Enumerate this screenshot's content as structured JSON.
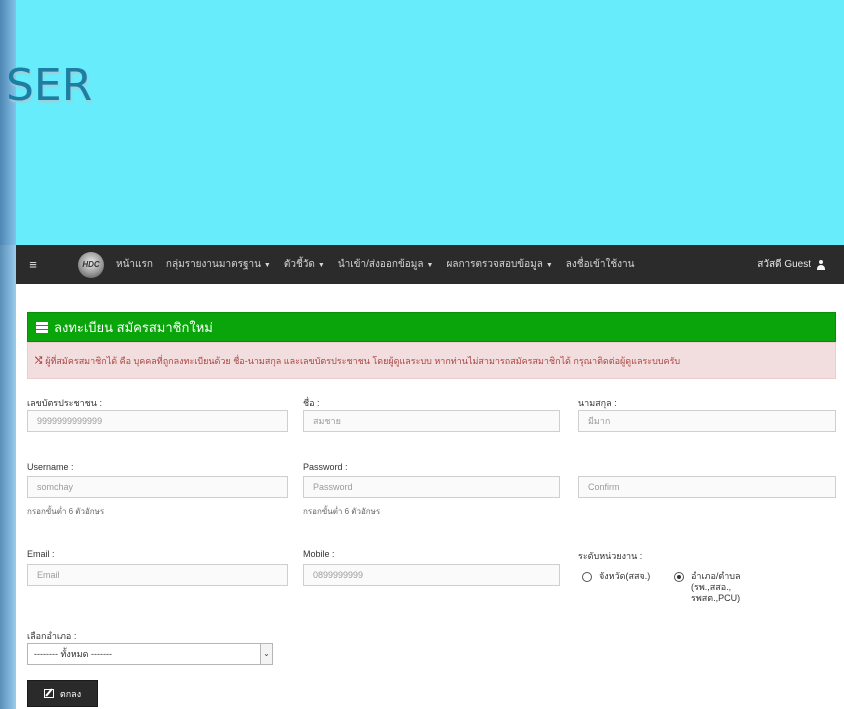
{
  "banner": {
    "text": "SER"
  },
  "nav": {
    "menu_icon": "hamburger-icon",
    "logo_text": "HDC",
    "items": [
      {
        "label": "หน้าแรก",
        "dropdown": false
      },
      {
        "label": "กลุ่มรายงานมาตรฐาน",
        "dropdown": true
      },
      {
        "label": "ตัวชี้วัด",
        "dropdown": true
      },
      {
        "label": "นำเข้า/ส่งออกข้อมูล",
        "dropdown": true
      },
      {
        "label": "ผลการตรวจสอบข้อมูล",
        "dropdown": true
      },
      {
        "label": "ลงชื่อเข้าใช้งาน",
        "dropdown": false
      }
    ],
    "user_greeting": "สวัสดี Guest",
    "user_icon": "user-icon"
  },
  "panel": {
    "title": "ลงทะเบียน สมัครสมาชิกใหม่",
    "title_icon": "list-icon"
  },
  "alert": {
    "icon": "shuffle-icon",
    "text": "ผู้ที่สมัครสมาชิกได้ คือ บุคคลที่ถูกลงทะเบียนด้วย ชื่อ-นามสกุล และเลขบัตรประชาชน โดยผู้ดูแลระบบ หากท่านไม่สามารถสมัครสมาชิกได้ กรุณาติดต่อผู้ดูแลระบบครับ"
  },
  "form": {
    "cid_label": "เลขบัตรประชาชน :",
    "cid_placeholder": "9999999999999",
    "fname_label": "ชื่อ :",
    "fname_placeholder": "สมชาย",
    "lname_label": "นามสกุล :",
    "lname_placeholder": "มีมาก",
    "username_label": "Username :",
    "username_placeholder": "somchay",
    "username_help": "กรอกขั้นต่ำ 6 ตัวอักษร",
    "password_label": "Password :",
    "password_placeholder": "Password",
    "password_help": "กรอกขั้นต่ำ 6 ตัวอักษร",
    "confirm_placeholder": "Confirm",
    "email_label": "Email :",
    "email_placeholder": "Email",
    "mobile_label": "Mobile :",
    "mobile_placeholder": "0899999999",
    "level_label": "ระดับหน่วยงาน :",
    "level_options": [
      {
        "label": "จังหวัด(สสจ.)",
        "checked": false
      },
      {
        "label": "อำเภอ/ตำบล (รพ.,สสอ., รพสต.,PCU)",
        "checked": true
      }
    ],
    "district_label": "เลือกอำเภอ :",
    "district_selected": "-------- ทั้งหมด -------",
    "submit_label": "ตกลง",
    "submit_icon": "edit-icon"
  }
}
